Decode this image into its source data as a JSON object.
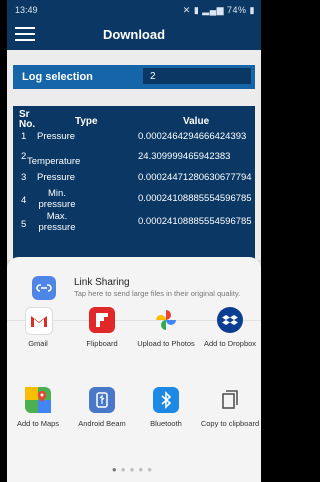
{
  "status_bar": {
    "time": "13:49",
    "battery": "74%"
  },
  "app_bar": {
    "title": "Download"
  },
  "log_selection": {
    "label": "Log selection",
    "value": "2"
  },
  "table": {
    "headers": {
      "sr": "Sr No.",
      "type": "Type",
      "value": "Value"
    },
    "rows": [
      {
        "sr": "1",
        "type": "Pressure",
        "value": "0.0002464294666424393"
      },
      {
        "sr": "2",
        "type": "Temperature",
        "value": "24.309999465942383"
      },
      {
        "sr": "3",
        "type": "Pressure",
        "value": "0.00024471280630677794"
      },
      {
        "sr": "4",
        "type": "Min. pressure",
        "value": "0.00024108885554596785"
      },
      {
        "sr": "5",
        "type": "Max. pressure",
        "value": "0.00024108885554596785"
      }
    ]
  },
  "share_sheet": {
    "link_sharing": {
      "title": "Link Sharing",
      "description": "Tap here to send large files in their original quality."
    },
    "apps": [
      {
        "label": "Gmail",
        "icon": "gmail-icon"
      },
      {
        "label": "Flipboard",
        "icon": "flipboard-icon"
      },
      {
        "label": "Upload to Photos",
        "icon": "photos-icon"
      },
      {
        "label": "Add to Dropbox",
        "icon": "dropbox-icon"
      },
      {
        "label": "Add to Maps",
        "icon": "maps-icon"
      },
      {
        "label": "Android Beam",
        "icon": "android-beam-icon"
      },
      {
        "label": "Bluetooth",
        "icon": "bluetooth-icon"
      },
      {
        "label": "Copy to clipboard",
        "icon": "clipboard-icon"
      }
    ],
    "page_indicator": {
      "count": 5,
      "active": 1
    }
  },
  "colors": {
    "appbar": "#0a3763",
    "log_selection_bar": "#1565a8",
    "table_bg": "#0a3763"
  }
}
